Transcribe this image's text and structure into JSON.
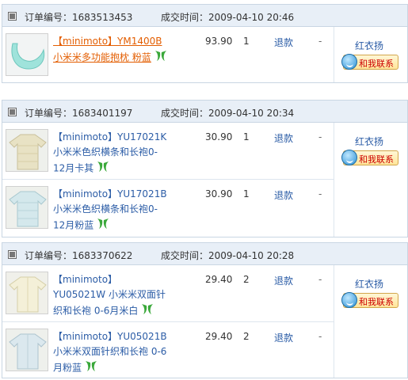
{
  "labels": {
    "order_no_prefix": "订单编号：",
    "time_prefix": "成交时间："
  },
  "orders": [
    {
      "order_no": "1683513453",
      "time": "2009-04-10 20:46",
      "seller": "红衣扬",
      "contact_label": "和我联系",
      "items": [
        {
          "title": "【minimoto】YM1400B 小米米多功能抱枕 粉蓝",
          "price": "93.90",
          "qty": "1",
          "refund": "退款",
          "dash": "-",
          "thumb": "pillow"
        }
      ]
    },
    {
      "order_no": "1683401197",
      "time": "2009-04-10 20:34",
      "seller": "红衣扬",
      "contact_label": "和我联系",
      "items": [
        {
          "title": "【minimoto】YU17021K小米米色织横条和长袍0-12月卡其",
          "price": "30.90",
          "qty": "1",
          "refund": "退款",
          "dash": "-",
          "thumb": "robe-khaki"
        },
        {
          "title": "【minimoto】YU17021B小米米色织横条和长袍0-12月粉蓝",
          "price": "30.90",
          "qty": "1",
          "refund": "退款",
          "dash": "-",
          "thumb": "robe-blue"
        }
      ]
    },
    {
      "order_no": "1683370622",
      "time": "2009-04-10 20:28",
      "seller": "红衣扬",
      "contact_label": "和我联系",
      "items": [
        {
          "title": "【minimoto】YU05021W 小米米双面针织和长袍 0-6月米白",
          "price": "29.40",
          "qty": "2",
          "refund": "退款",
          "dash": "-",
          "thumb": "robe-white"
        },
        {
          "title": "【minimoto】YU05021B 小米米双面针织和长袍 0-6月粉蓝",
          "price": "29.40",
          "qty": "2",
          "refund": "退款",
          "dash": "-",
          "thumb": "robe-blue2"
        }
      ]
    }
  ]
}
